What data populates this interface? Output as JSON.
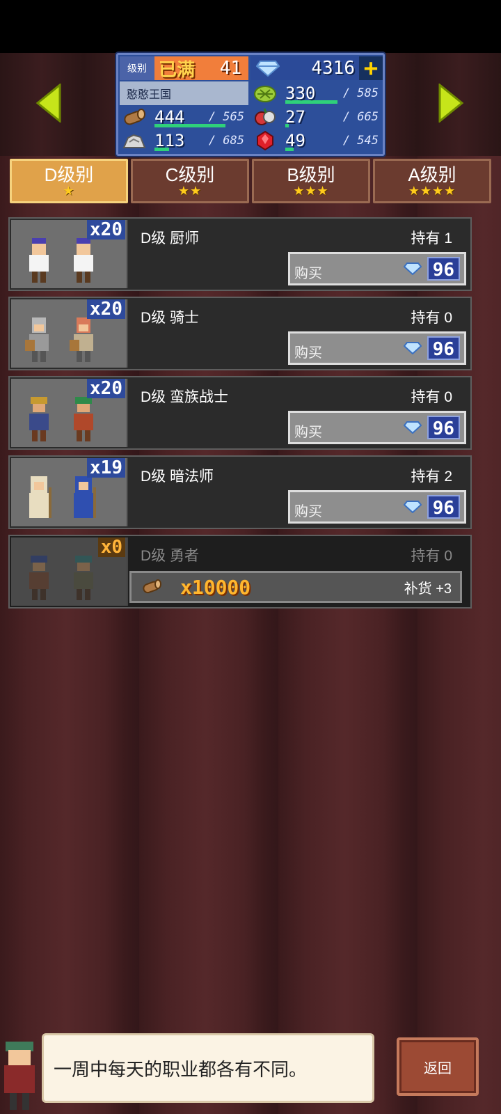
{
  "header": {
    "level_label": "级别",
    "level_status": "已满",
    "level_value": "41",
    "gems": "4316",
    "plus_symbol": "+",
    "kingdom": "憨憨王国",
    "resources": [
      {
        "icon": "wood-icon",
        "value": "444",
        "max": "/ 565",
        "fill": 0.79
      },
      {
        "icon": "grass-icon",
        "value": "330",
        "max": "/ 585",
        "fill": 0.56
      },
      {
        "icon": "food-icon",
        "value": "27",
        "max": "/ 665",
        "fill": 0.04
      },
      {
        "icon": "ore-icon",
        "value": "113",
        "max": "/ 685",
        "fill": 0.16
      },
      {
        "icon": "ruby-icon",
        "value": "49",
        "max": "/ 545",
        "fill": 0.09
      }
    ]
  },
  "tabs": [
    {
      "label": "D级别",
      "stars": "★",
      "active": true
    },
    {
      "label": "C级别",
      "stars": "★★",
      "active": false
    },
    {
      "label": "B级别",
      "stars": "★★★",
      "active": false
    },
    {
      "label": "A级别",
      "stars": "★★★★",
      "active": false
    }
  ],
  "jobs": [
    {
      "name": "D级 厨师",
      "owned": "持有 1",
      "count": "x20",
      "buy_label": "购买",
      "price": "96"
    },
    {
      "name": "D级 骑士",
      "owned": "持有 0",
      "count": "x20",
      "buy_label": "购买",
      "price": "96"
    },
    {
      "name": "D级 蛮族战士",
      "owned": "持有 0",
      "count": "x20",
      "buy_label": "购买",
      "price": "96"
    },
    {
      "name": "D级 暗法师",
      "owned": "持有 2",
      "count": "x19",
      "buy_label": "购买",
      "price": "96"
    },
    {
      "name": "D级 勇者",
      "owned": "持有 0",
      "count": "x0",
      "restock_cost": "x10000",
      "restock_label": "补货 +3"
    }
  ],
  "tip": "一周中每天的职业都各有不同。",
  "back_label": "返回",
  "colors": {
    "accent_tab": "#e0a24a",
    "price_bg": "#2a3f98",
    "bar": "#2fd17a"
  }
}
